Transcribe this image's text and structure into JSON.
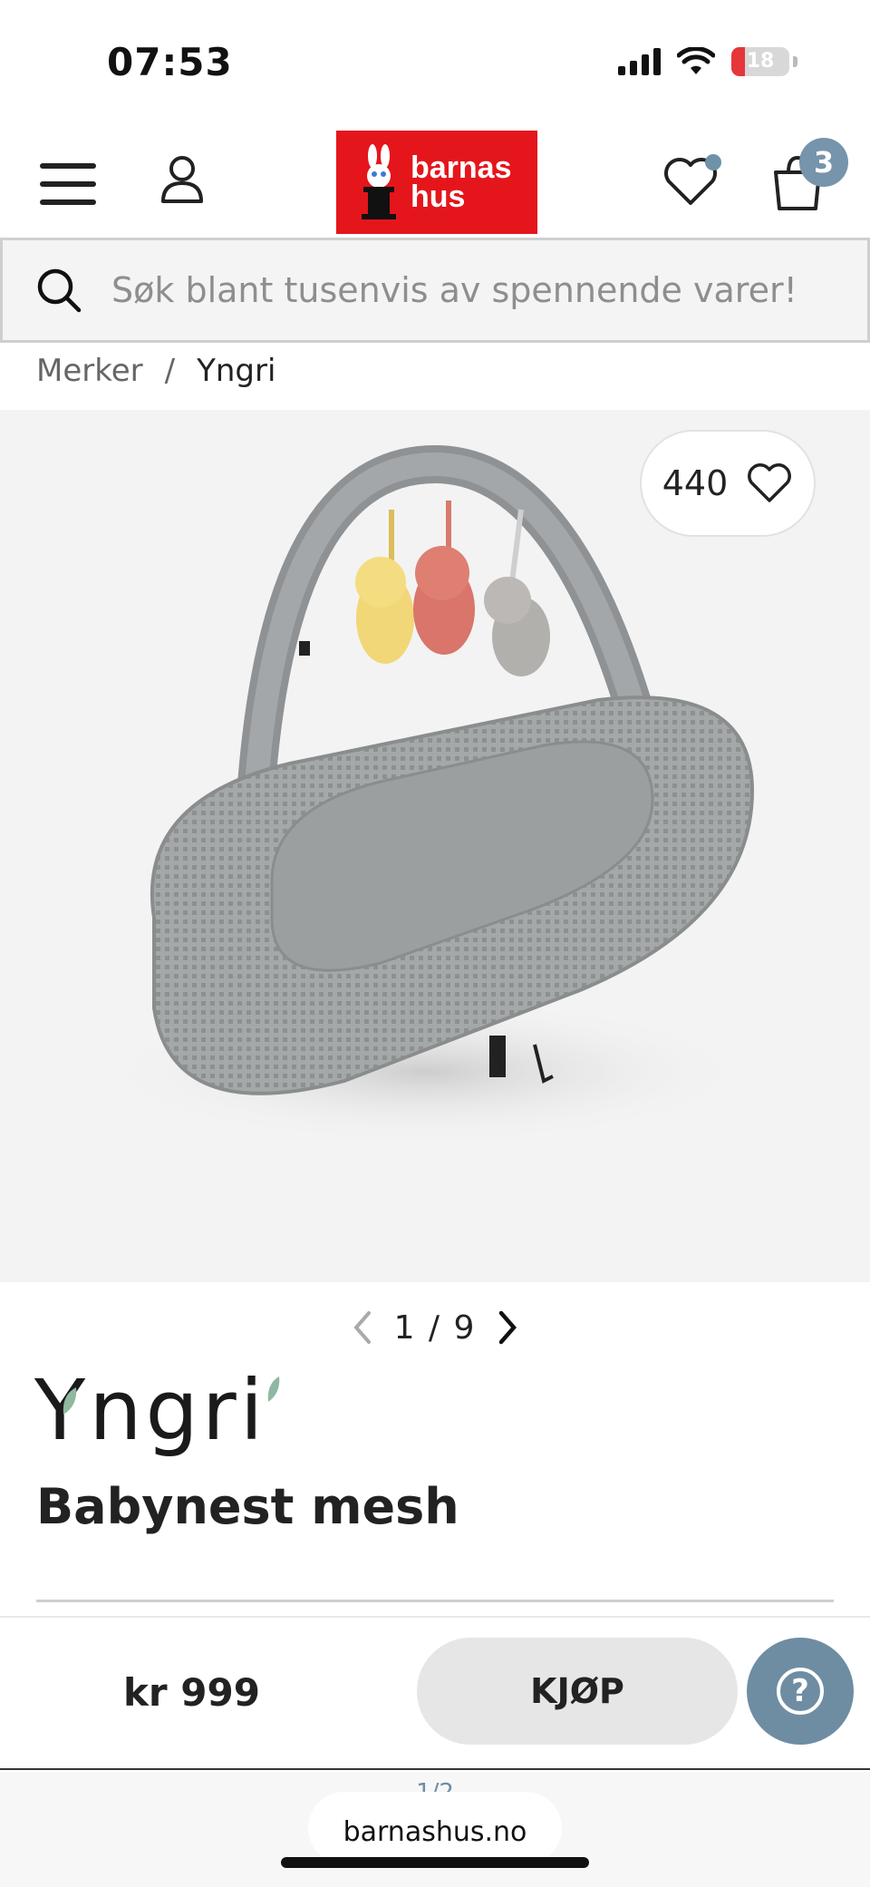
{
  "status_bar": {
    "time": "07:53",
    "battery": "18",
    "icons": [
      "signal-icon",
      "wifi-icon",
      "battery-icon"
    ]
  },
  "header": {
    "logo_line1": "barnas",
    "logo_line2": "hus",
    "cart_count": "3",
    "brand_color": "#e4161b",
    "accent_color": "#6e8da3"
  },
  "search": {
    "placeholder": "Søk blant tusenvis av spennende varer!"
  },
  "breadcrumb": {
    "items": [
      "Merker",
      "Yngri"
    ],
    "separator": "/"
  },
  "gallery": {
    "likes": "440",
    "current": "1",
    "total": "9",
    "separator": "/"
  },
  "product": {
    "brand": "Yngri",
    "title": "Babynest mesh",
    "price": "kr 999",
    "buy_label": "KJØP",
    "help_label": "?"
  },
  "browser": {
    "page_count": "1/2",
    "url": "barnashus.no"
  }
}
